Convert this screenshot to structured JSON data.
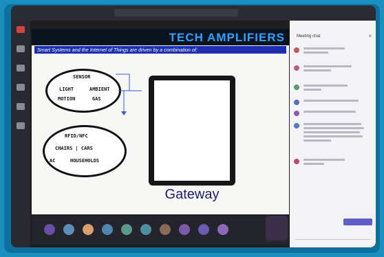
{
  "app": {
    "meeting_name": "",
    "search_placeholder": ""
  },
  "slide": {
    "title": "TECH AMPLIFIERS",
    "subtitle": "Smart Systems and the Internet of Things are driven by a combination of:",
    "bubble1": [
      "SENSOR",
      "LIGHT",
      "MOTION",
      "AMBIENT",
      "GAS"
    ],
    "bubble2": [
      "RFID/NFC",
      "CHAIRS | CARS",
      "AC",
      "HOUSEHOLDS"
    ],
    "gateway_label": "Gateway"
  },
  "chat": {
    "title": "Meeting chat",
    "new_message_label": "",
    "compose_placeholder": ""
  },
  "colors": {
    "accent": "#2da3ff",
    "subtitle_bg": "#1b2fb0",
    "teams_purple": "#5b5fc7"
  },
  "icons": [
    "chat-icon",
    "teams-icon",
    "calendar-icon",
    "calls-icon",
    "files-icon",
    "close-icon",
    "new-message-icon"
  ]
}
